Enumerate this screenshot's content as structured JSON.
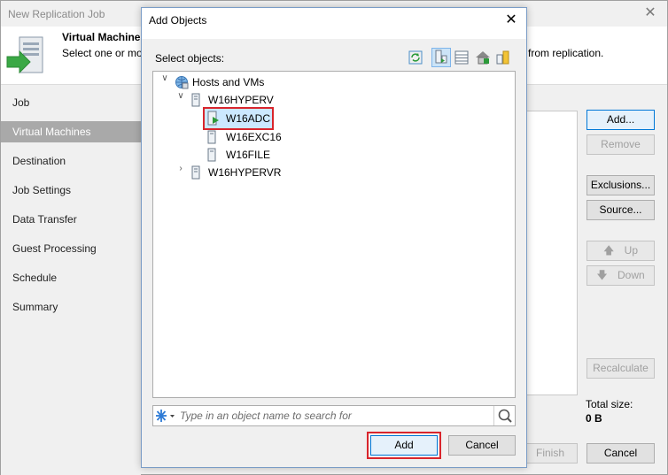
{
  "window": {
    "title": "New Replication Job",
    "close": "✕"
  },
  "header": {
    "title": "Virtual Machines",
    "description": "Select one or mo",
    "description_tail": "from replication."
  },
  "nav": {
    "items": [
      {
        "label": "Job"
      },
      {
        "label": "Virtual Machines"
      },
      {
        "label": "Destination"
      },
      {
        "label": "Job Settings"
      },
      {
        "label": "Data Transfer"
      },
      {
        "label": "Guest Processing"
      },
      {
        "label": "Schedule"
      },
      {
        "label": "Summary"
      }
    ],
    "active_index": 1
  },
  "side_buttons": {
    "add": "Add...",
    "remove": "Remove",
    "exclusions": "Exclusions...",
    "source": "Source...",
    "up": "Up",
    "down": "Down",
    "recalculate": "Recalculate"
  },
  "totals": {
    "label": "Total size:",
    "value": "0 B"
  },
  "footer": {
    "finish": "Finish",
    "cancel": "Cancel"
  },
  "dialog": {
    "title": "Add Objects",
    "close": "✕",
    "select_label": "Select objects:",
    "tree": {
      "root": "Hosts and VMs",
      "host1": "W16HYPERV",
      "vms": [
        "W16ADC",
        "W16EXC16",
        "W16FILE"
      ],
      "host2": "W16HYPERVR",
      "selected": "W16ADC"
    },
    "search_placeholder": "Type in an object name to search for",
    "add_button": "Add",
    "cancel_button": "Cancel"
  },
  "colors": {
    "highlight": "#d9252c",
    "selection": "#cce8ff",
    "accent": "#0078d7"
  }
}
